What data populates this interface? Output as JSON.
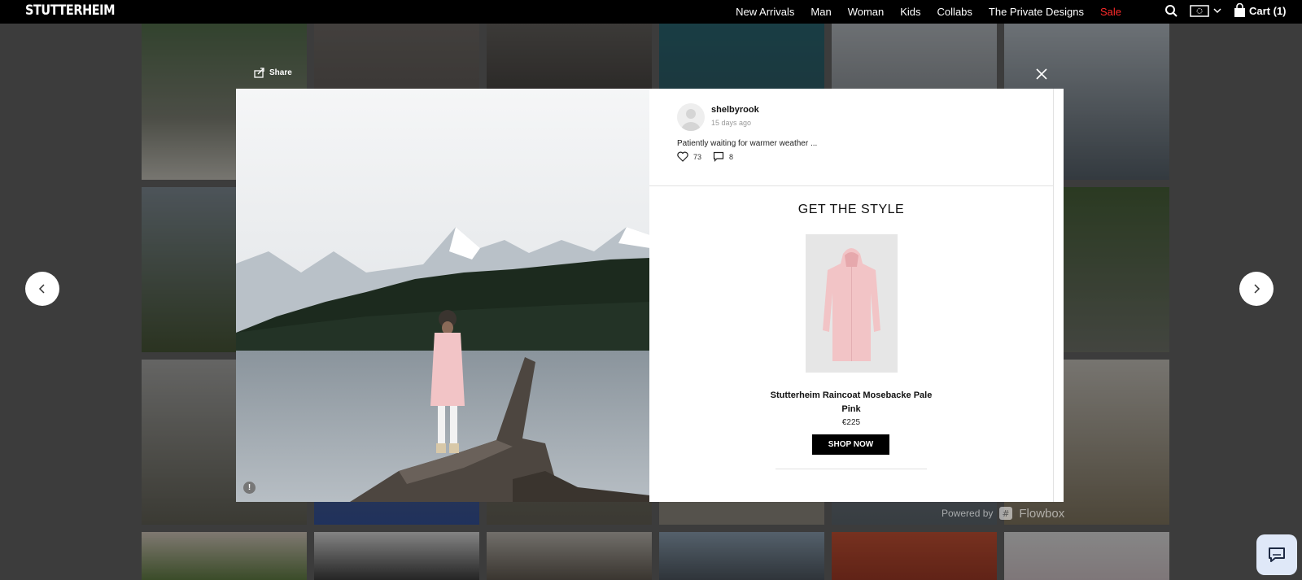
{
  "header": {
    "logo": "STUTTERHEIM",
    "nav": [
      "New Arrivals",
      "Man",
      "Woman",
      "Kids",
      "Collabs",
      "The Private Designs",
      "Sale"
    ],
    "cart_label": "Cart (1)"
  },
  "modal": {
    "share_label": "Share",
    "info_icon_label": "!",
    "post": {
      "username": "shelbyrook",
      "time_ago": "15 days ago",
      "caption": "Patiently waiting for warmer weather ...",
      "likes": "73",
      "comments": "8"
    },
    "get_the_style": "GET THE STYLE",
    "product": {
      "name": "Stutterheim Raincoat Mosebacke Pale Pink",
      "price": "€225",
      "cta": "SHOP NOW"
    },
    "powered_by": "Powered by",
    "powered_brand": "Flowbox"
  },
  "colors": {
    "sale": "#ff2a2a",
    "coat_pink": "#f2c4c6",
    "header_bg": "#000000"
  }
}
